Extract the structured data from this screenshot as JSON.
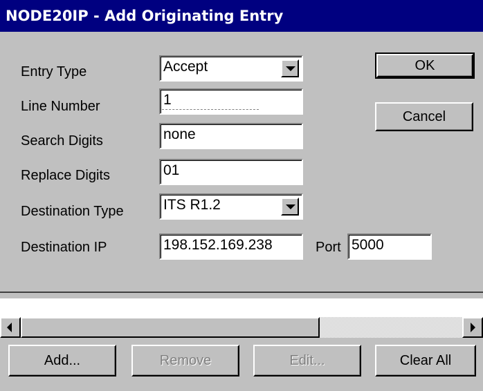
{
  "window": {
    "title": "NODE20IP - Add Originating Entry"
  },
  "form": {
    "entry_type": {
      "label": "Entry Type",
      "value": "Accept"
    },
    "line_number": {
      "label": "Line Number",
      "value": "1"
    },
    "search_digits": {
      "label": "Search Digits",
      "value": "none"
    },
    "replace_digits": {
      "label": "Replace Digits",
      "value": "01"
    },
    "destination_type": {
      "label": "Destination Type",
      "value": "ITS R1.2"
    },
    "destination_ip": {
      "label": "Destination IP",
      "value": "198.152.169.238"
    },
    "port": {
      "label": "Port",
      "value": "5000"
    }
  },
  "buttons": {
    "ok": "OK",
    "cancel": "Cancel"
  },
  "bottom_buttons": {
    "add": "Add...",
    "remove": "Remove",
    "edit": "Edit...",
    "clear_all": "Clear All"
  },
  "colors": {
    "titlebar": "#000080",
    "face": "#c0c0c0",
    "field": "#ffffff"
  }
}
